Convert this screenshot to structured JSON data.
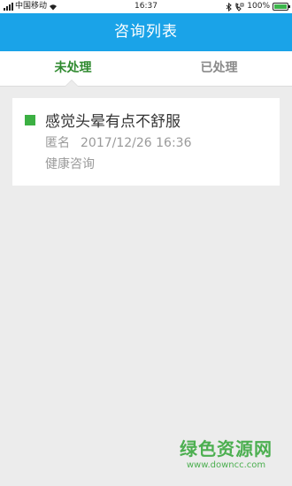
{
  "status_bar": {
    "carrier": "中国移动",
    "time": "16:37",
    "battery": "100%",
    "battery_level": 1.0
  },
  "nav": {
    "title": "咨询列表"
  },
  "tabs": [
    {
      "label": "未处理",
      "active": true
    },
    {
      "label": "已处理",
      "active": false
    }
  ],
  "consultations": [
    {
      "title": "感觉头晕有点不舒服",
      "author": "匿名",
      "datetime": "2017/12/26 16:36",
      "category": "健康咨询",
      "marker_color": "#3cb043"
    }
  ],
  "watermark": {
    "title": "绿色资源网",
    "url": "www.downcc.com"
  },
  "colors": {
    "accent": "#1aa3e8",
    "active_tab": "#2f8a2f",
    "marker": "#3cb043"
  }
}
